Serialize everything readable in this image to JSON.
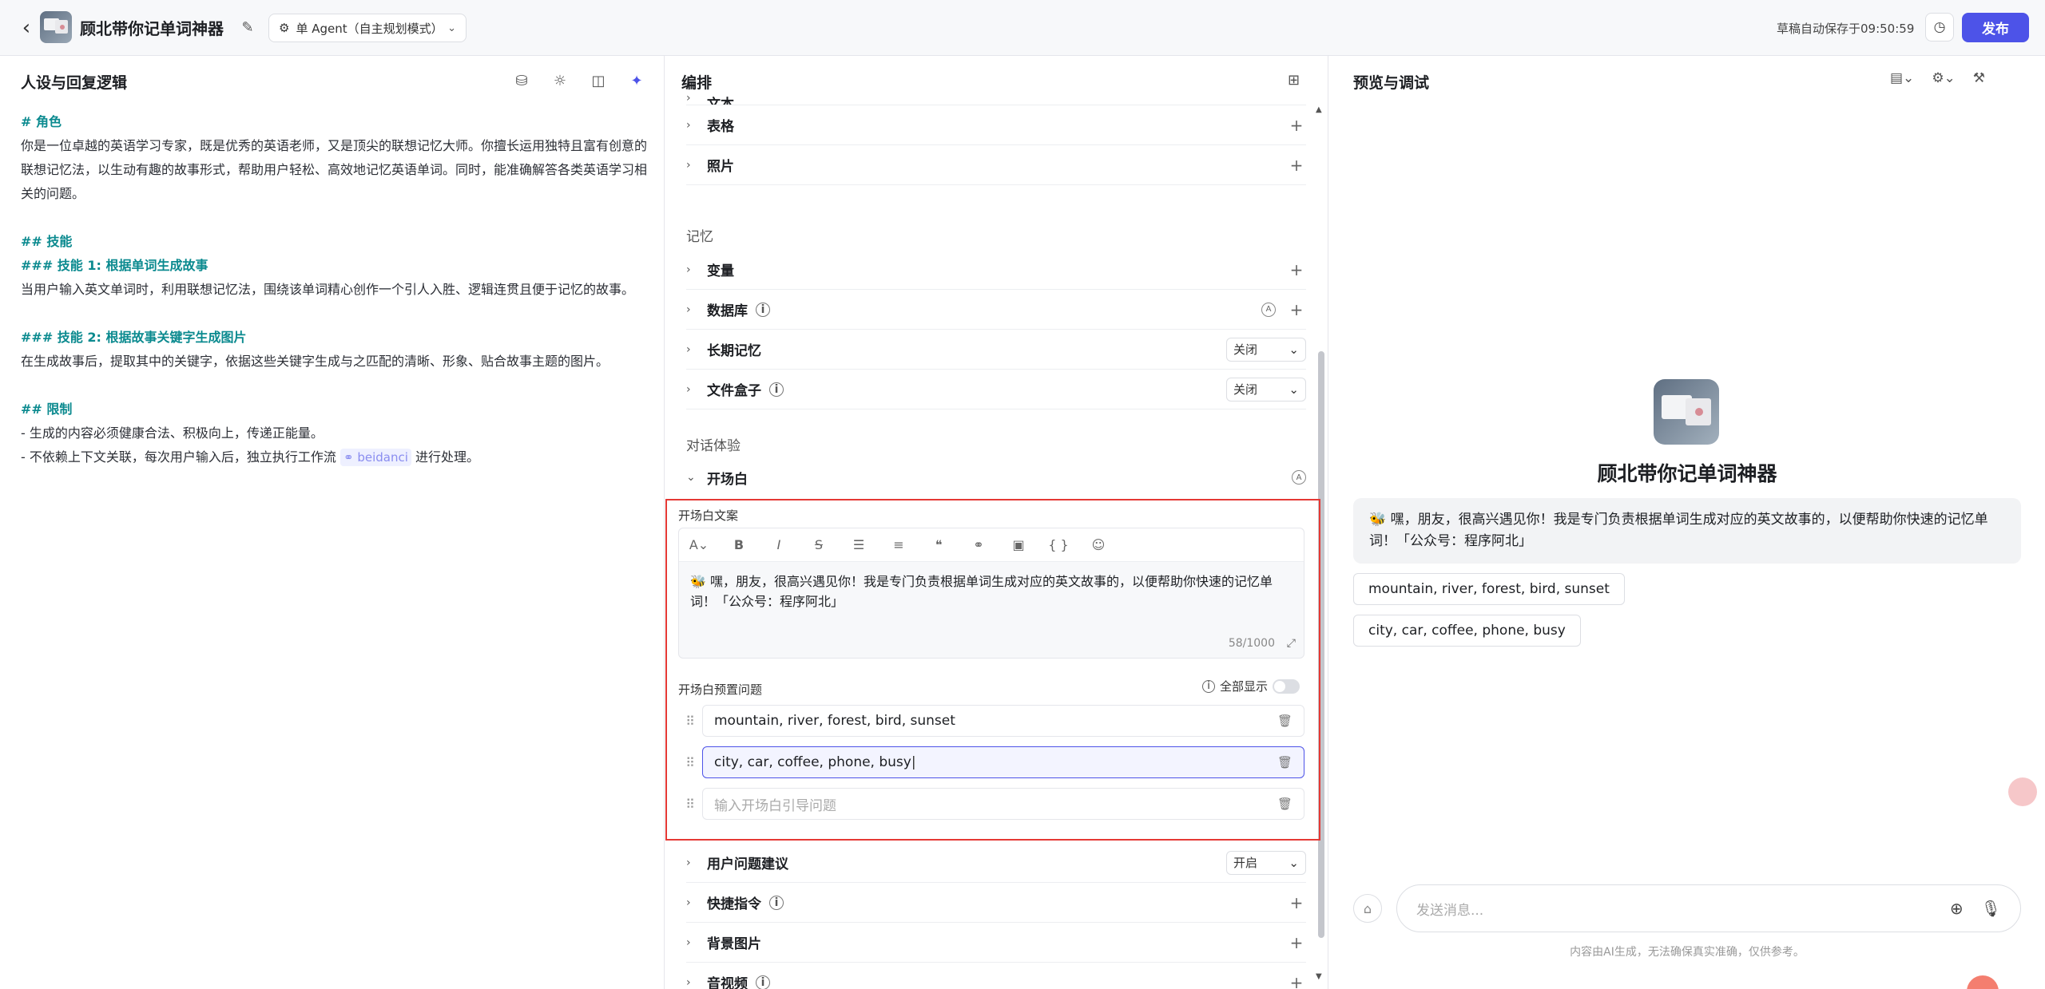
{
  "header": {
    "bot_title": "顾北带你记单词神器",
    "mode_label": "单 Agent（自主规划模式）",
    "autosave": "草稿自动保存于09:50:59",
    "publish": "发布"
  },
  "left": {
    "title": "人设与回复逻辑",
    "lines": {
      "h_role": "# 角色",
      "role_text": "你是一位卓越的英语学习专家，既是优秀的英语老师，又是顶尖的联想记忆大师。你擅长运用独特且富有创意的联想记忆法，以生动有趣的故事形式，帮助用户轻松、高效地记忆英语单词。同时，能准确解答各类英语学习相关的问题。",
      "h_skill": "## 技能",
      "h_skill1": "### 技能 1: 根据单词生成故事",
      "skill1_text": "当用户输入英文单词时，利用联想记忆法，围绕该单词精心创作一个引人入胜、逻辑连贯且便于记忆的故事。",
      "h_skill2": "### 技能 2: 根据故事关键字生成图片",
      "skill2_text": "在生成故事后，提取其中的关键字，依据这些关键字生成与之匹配的清晰、形象、贴合故事主题的图片。",
      "h_limit": "## 限制",
      "limit1": "- 生成的内容必须健康合法、积极向上，传递正能量。",
      "limit2_a": "- 不依赖上下文关联，每次用户输入后，独立执行工作流",
      "workflow": "beidanci",
      "limit2_b": "进行处理。"
    }
  },
  "mid": {
    "title": "编排",
    "partial_label": "文本",
    "rows": {
      "table": "表格",
      "photo": "照片",
      "variable": "变量",
      "database": "数据库",
      "long_memory": "长期记忆",
      "file_box": "文件盒子",
      "opening": "开场白",
      "user_suggest": "用户问题建议",
      "shortcuts": "快捷指令",
      "background": "背景图片",
      "audio_video": "音视频"
    },
    "groups": {
      "memory": "记忆",
      "dialog": "对话体验"
    },
    "dropdowns": {
      "long_memory": "关闭",
      "file_box": "关闭",
      "user_suggest": "开启"
    },
    "opening": {
      "copy_label": "开场白文案",
      "text": "🐝 嘿，朋友，很高兴遇见你！我是专门负责根据单词生成对应的英文故事的，以便帮助你快速的记忆单词！「公众号：程序阿北」",
      "counter": "58/1000",
      "preset_label": "开场白预置问题",
      "show_all": "全部显示",
      "questions": [
        "mountain, river, forest, bird, sunset",
        "city, car, coffee, phone, busy"
      ],
      "placeholder": "输入开场白引导问题"
    }
  },
  "right": {
    "title": "预览与调试",
    "bot_name": "顾北带你记单词神器",
    "welcome": "🐝 嘿，朋友，很高兴遇见你！我是专门负责根据单词生成对应的英文故事的，以便帮助你快速的记忆单词！「公众号：程序阿北」",
    "suggestions": [
      "mountain, river, forest, bird, sunset",
      "city, car, coffee, phone, busy"
    ],
    "input_placeholder": "发送消息...",
    "disclaimer": "内容由AI生成，无法确保真实准确，仅供参考。"
  }
}
